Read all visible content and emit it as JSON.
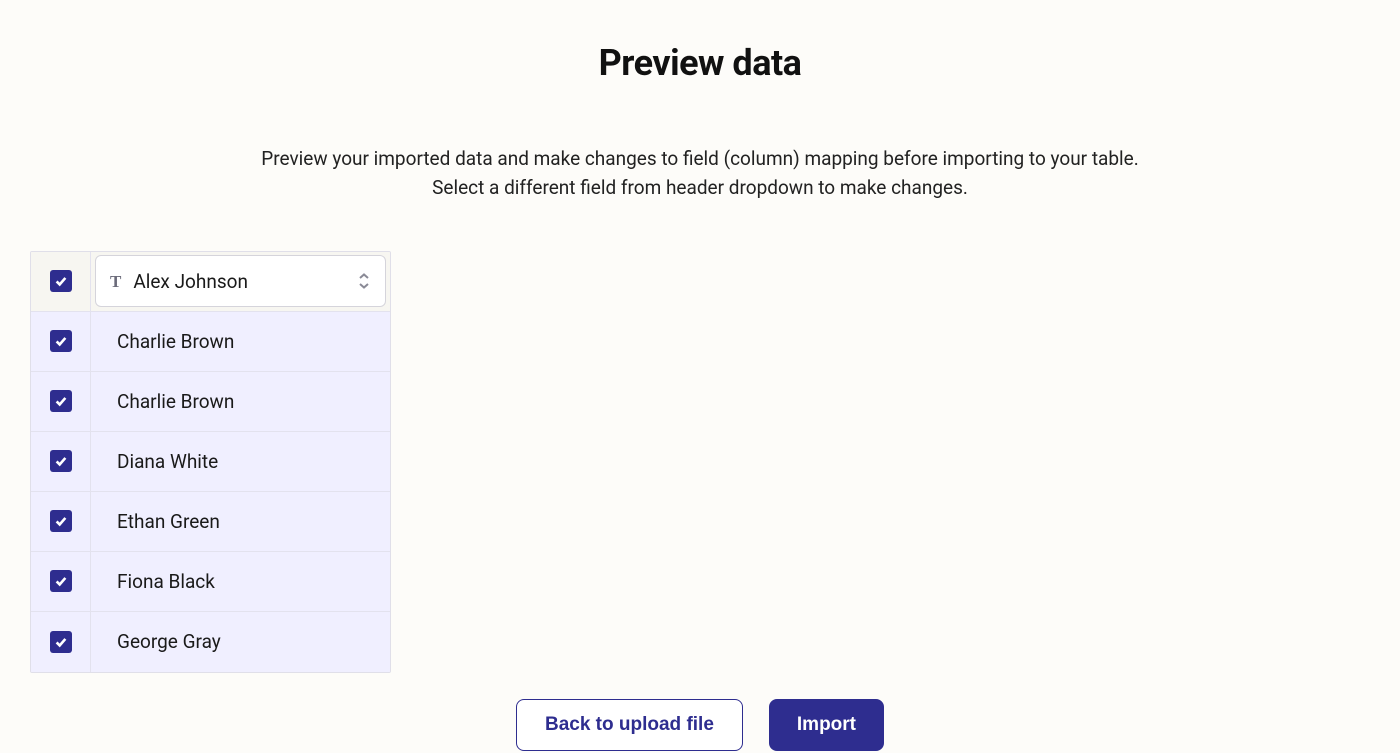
{
  "page": {
    "title": "Preview data",
    "description_line1": "Preview your imported data and make changes to field (column) mapping before importing to your table.",
    "description_line2": "Select a different field from header dropdown to make changes."
  },
  "column": {
    "mapped_field": "Alex Johnson",
    "type_icon": "T"
  },
  "rows": [
    {
      "value": "Charlie Brown",
      "selected": true
    },
    {
      "value": "Charlie Brown",
      "selected": true
    },
    {
      "value": "Diana White",
      "selected": true
    },
    {
      "value": "Ethan Green",
      "selected": true
    },
    {
      "value": "Fiona Black",
      "selected": true
    },
    {
      "value": "George Gray",
      "selected": true
    }
  ],
  "buttons": {
    "back": "Back to upload file",
    "import": "Import"
  }
}
